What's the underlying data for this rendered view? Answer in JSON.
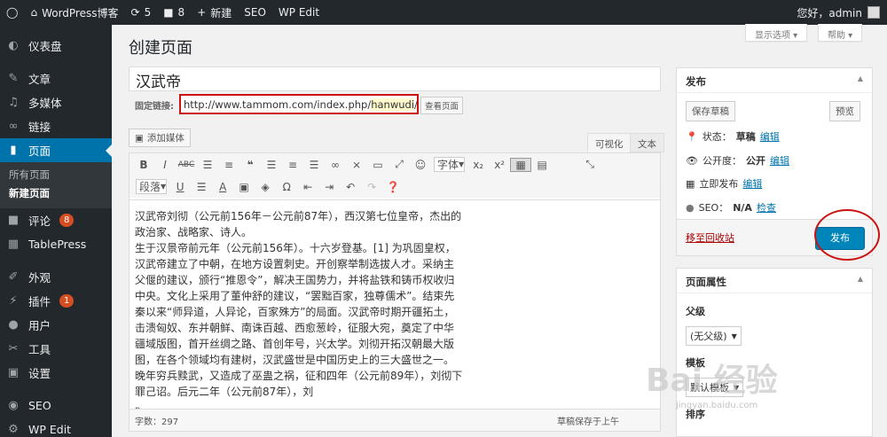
{
  "adminbar": {
    "site": "WordPress博客",
    "updates": "5",
    "comments": "8",
    "new": "新建",
    "seo": "SEO",
    "wpedit": "WP Edit",
    "greeting": "您好，admin"
  },
  "menu": {
    "dashboard": "仪表盘",
    "posts": "文章",
    "media": "多媒体",
    "links": "链接",
    "pages": "页面",
    "pages_all": "所有页面",
    "pages_new": "新建页面",
    "comments": "评论",
    "comments_count": "8",
    "tablepress": "TablePress",
    "appearance": "外观",
    "plugins": "插件",
    "plugins_count": "1",
    "users": "用户",
    "tools": "工具",
    "settings": "设置",
    "seo": "SEO",
    "wpedit": "WP Edit"
  },
  "header": {
    "title": "创建页面",
    "screen_options": "显示选项 ▾",
    "help": "帮助 ▾"
  },
  "post": {
    "title": "汉武帝",
    "permalink_label": "固定链接:",
    "permalink_base": "http://www.tammom.com/index.php/",
    "permalink_slug": "hanwudi",
    "permalink_end": "/",
    "edit_btn": "编辑",
    "view_btn": "查看页面"
  },
  "editor": {
    "add_media": "添加媒体",
    "tab_visual": "可视化",
    "tab_text": "文本",
    "font_select": "字体",
    "format_select": "段落",
    "content": [
      "汉武帝刘彻（公元前156年－公元前87年），西汉第七位皇帝，杰出的政治家、战略家、诗人。",
      "生于汉景帝前元年（公元前156年）。十六岁登基。[1] 为巩固皇权，汉武帝建立了中朝，在地方设置刺史。开创察举制选拔人才。采纳主父偃的建议，颁行“推恩令”，解决王国势力，并将盐铁和铸币权收归中央。文化上采用了董仲舒的建议，“罢黜百家，独尊儒术”。结束先秦以来“师异道，人异论，百家殊方”的局面。汉武帝时期开疆拓土，击溃匈奴、东并朝鲜、南诛百越、西愈葱岭，征服大宛，奠定了中华疆域版图，首开丝绸之路、首创年号，兴太学。刘彻开拓汉朝最大版图，在各个领域均有建树，汉武盛世是中国历史上的三大盛世之一。晚年穷兵黩武，又造成了巫蛊之祸，征和四年（公元前89年），刘彻下罪己诏。后元二年（公元前87年），刘"
    ],
    "path": "p",
    "word_count": "字数：297",
    "draft_saved": "草稿保存于上午"
  },
  "publish": {
    "title": "发布",
    "save_draft": "保存草稿",
    "preview": "预览",
    "status_label": "状态：",
    "status_value": "草稿",
    "visibility_label": "公开度：",
    "visibility_value": "公开",
    "schedule_label": "立即发布",
    "edit": "编辑",
    "seo_label": "SEO：",
    "seo_value": "N/A",
    "check": "检查",
    "trash": "移至回收站",
    "publish_btn": "发布"
  },
  "attributes": {
    "title": "页面属性",
    "parent_label": "父级",
    "parent_value": "(无父级)",
    "template_label": "模板",
    "template_value": "默认模板",
    "order_label": "排序"
  },
  "watermark": {
    "brand": "Bai 经验",
    "url": "jingyan.baidu.com"
  }
}
